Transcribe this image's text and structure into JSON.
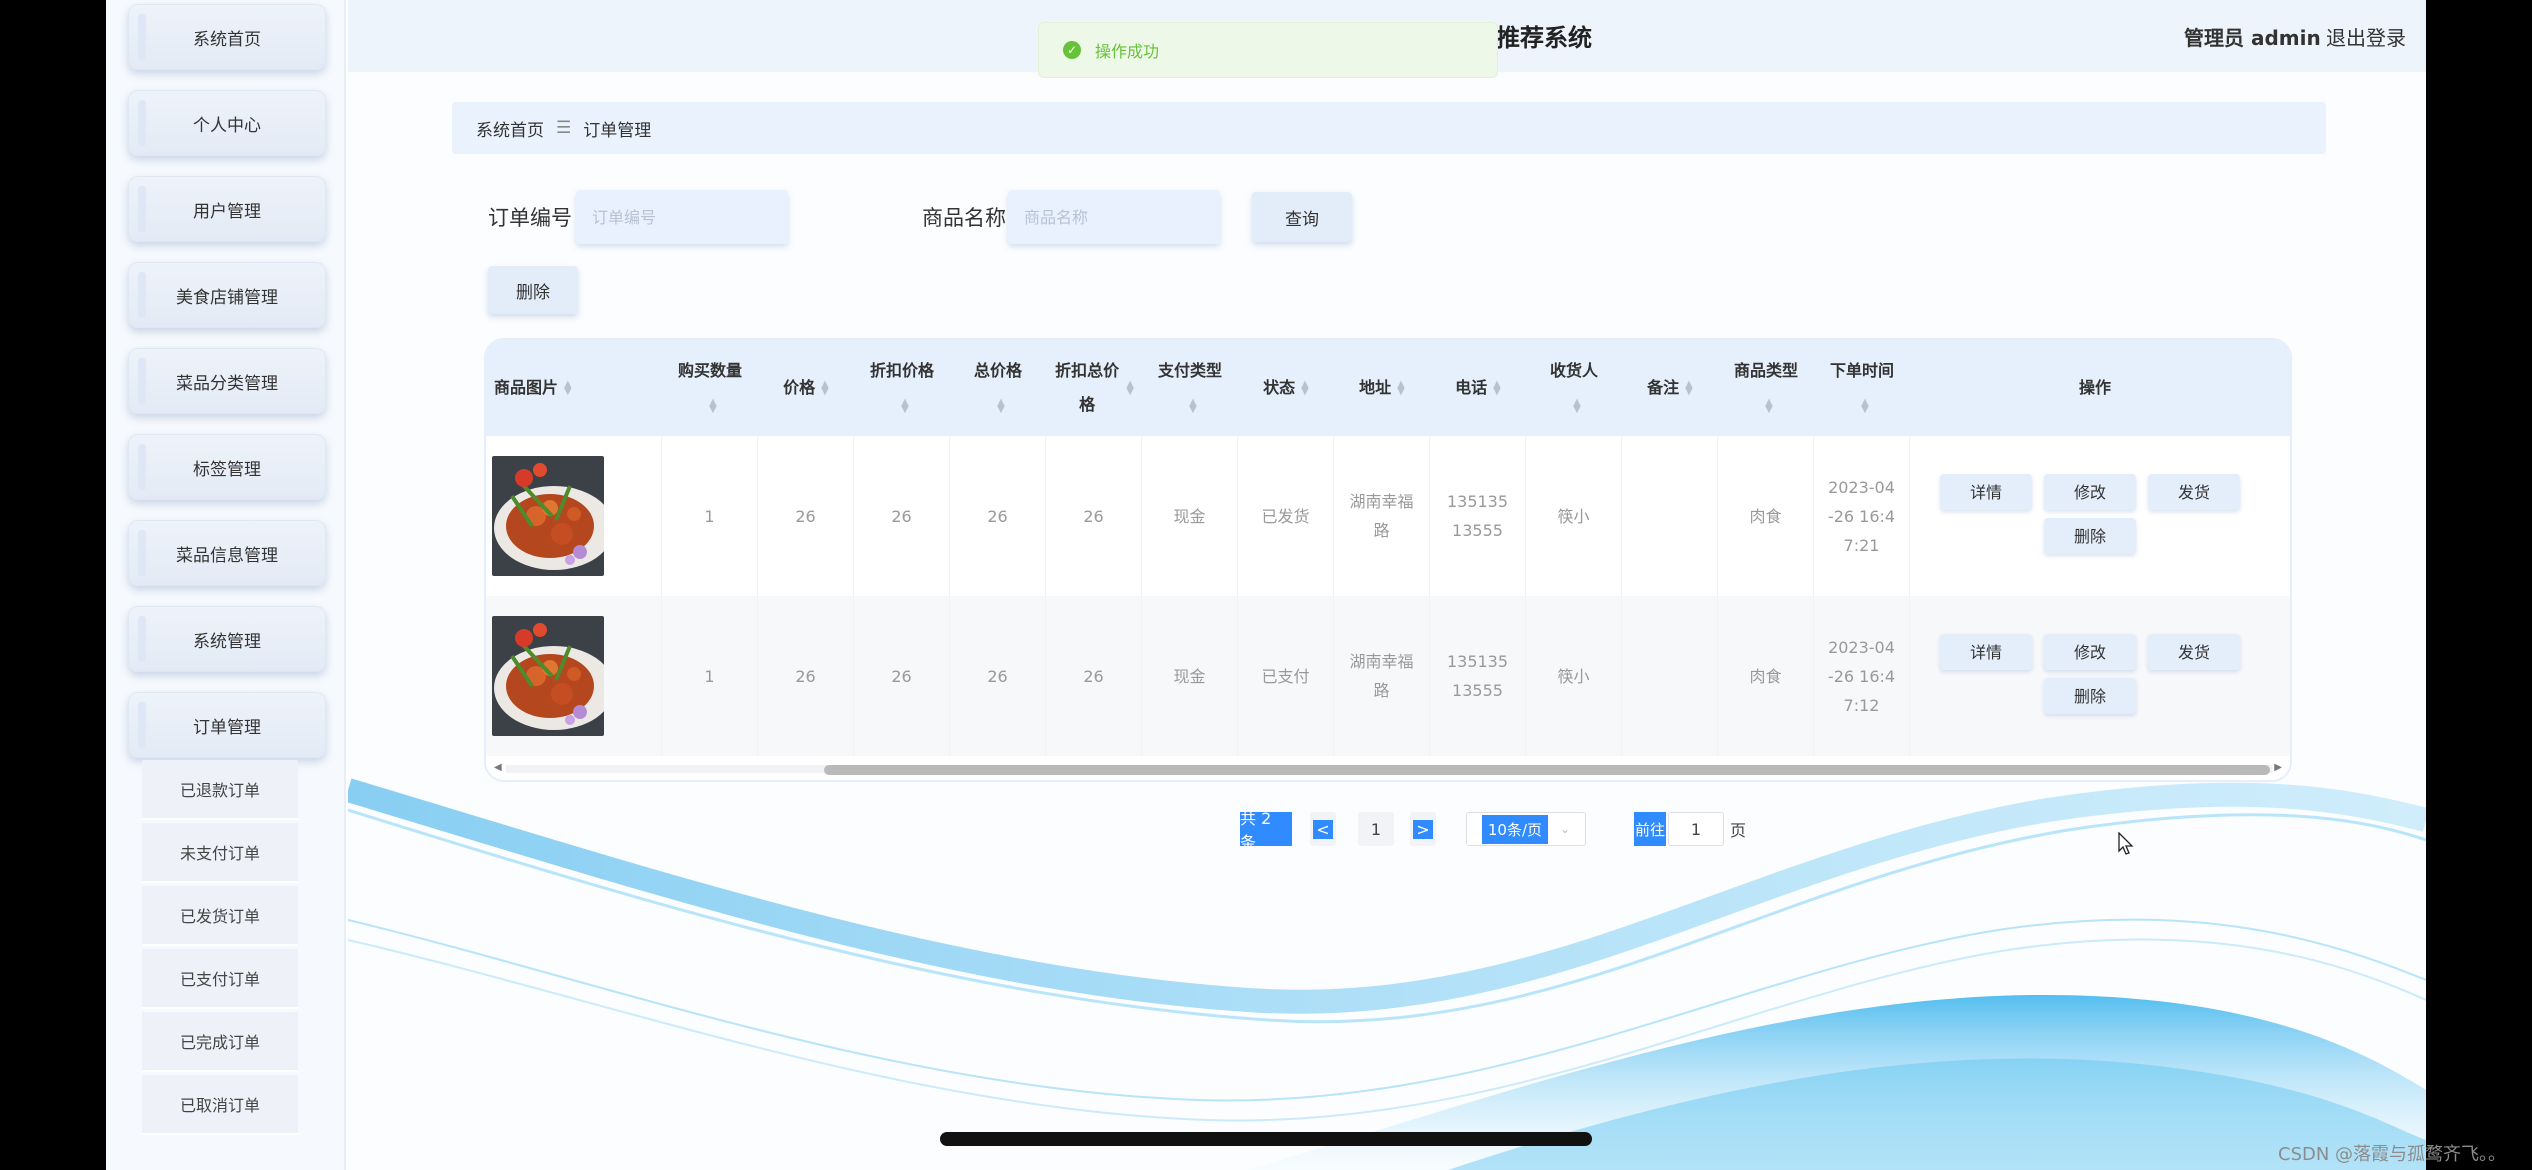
{
  "app": {
    "title_partial": "推荐系统",
    "admin_label": "管理员 admin",
    "logout_label": "退出登录"
  },
  "toast": {
    "message": "操作成功",
    "icon": "check-circle-icon",
    "color": "#67c23a"
  },
  "sidebar": {
    "items": [
      {
        "label": "系统首页"
      },
      {
        "label": "个人中心"
      },
      {
        "label": "用户管理"
      },
      {
        "label": "美食店铺管理"
      },
      {
        "label": "菜品分类管理"
      },
      {
        "label": "标签管理"
      },
      {
        "label": "菜品信息管理"
      },
      {
        "label": "系统管理"
      },
      {
        "label": "订单管理"
      }
    ],
    "subitems": [
      {
        "label": "已退款订单"
      },
      {
        "label": "未支付订单"
      },
      {
        "label": "已发货订单"
      },
      {
        "label": "已支付订单"
      },
      {
        "label": "已完成订单"
      },
      {
        "label": "已取消订单"
      }
    ]
  },
  "breadcrumb": {
    "home": "系统首页",
    "separator": "☰",
    "current": "订单管理"
  },
  "search": {
    "order_no_label": "订单编号",
    "order_no_placeholder": "订单编号",
    "product_label": "商品名称",
    "product_placeholder": "商品名称",
    "query_button": "查询",
    "delete_button": "删除"
  },
  "table": {
    "headers": {
      "image": "商品图片",
      "qty": "购买数量",
      "price": "价格",
      "disc_price": "折扣价格",
      "total": "总价格",
      "disc_total": "折扣总价格",
      "pay_type": "支付类型",
      "status": "状态",
      "address": "地址",
      "phone": "电话",
      "receiver": "收货人",
      "remark": "备注",
      "category": "商品类型",
      "time": "下单时间",
      "ops": "操作"
    },
    "rows": [
      {
        "qty": "1",
        "price": "26",
        "disc_price": "26",
        "total": "26",
        "disc_total": "26",
        "pay_type": "现金",
        "status": "已发货",
        "address": "湖南幸福路",
        "phone": "13513513555",
        "receiver": "筷小",
        "remark": "",
        "category": "肉食",
        "time": "2023-04-26 16:47:21"
      },
      {
        "qty": "1",
        "price": "26",
        "disc_price": "26",
        "total": "26",
        "disc_total": "26",
        "pay_type": "现金",
        "status": "已支付",
        "address": "湖南幸福路",
        "phone": "13513513555",
        "receiver": "筷小",
        "remark": "",
        "category": "肉食",
        "time": "2023-04-26 16:47:12"
      }
    ],
    "ops": {
      "detail": "详情",
      "edit": "修改",
      "ship": "发货",
      "delete": "删除"
    }
  },
  "pagination": {
    "total_text": "共 2 条",
    "prev": "<",
    "current_page": "1",
    "next": ">",
    "page_size": "10条/页",
    "goto_label": "前往",
    "goto_value": "1",
    "page_unit": "页"
  },
  "watermark": "CSDN @落霞与孤鹜齐飞。。",
  "colors": {
    "accent": "#2f8bff",
    "header_bg": "#e6f0fd",
    "success": "#67c23a"
  }
}
